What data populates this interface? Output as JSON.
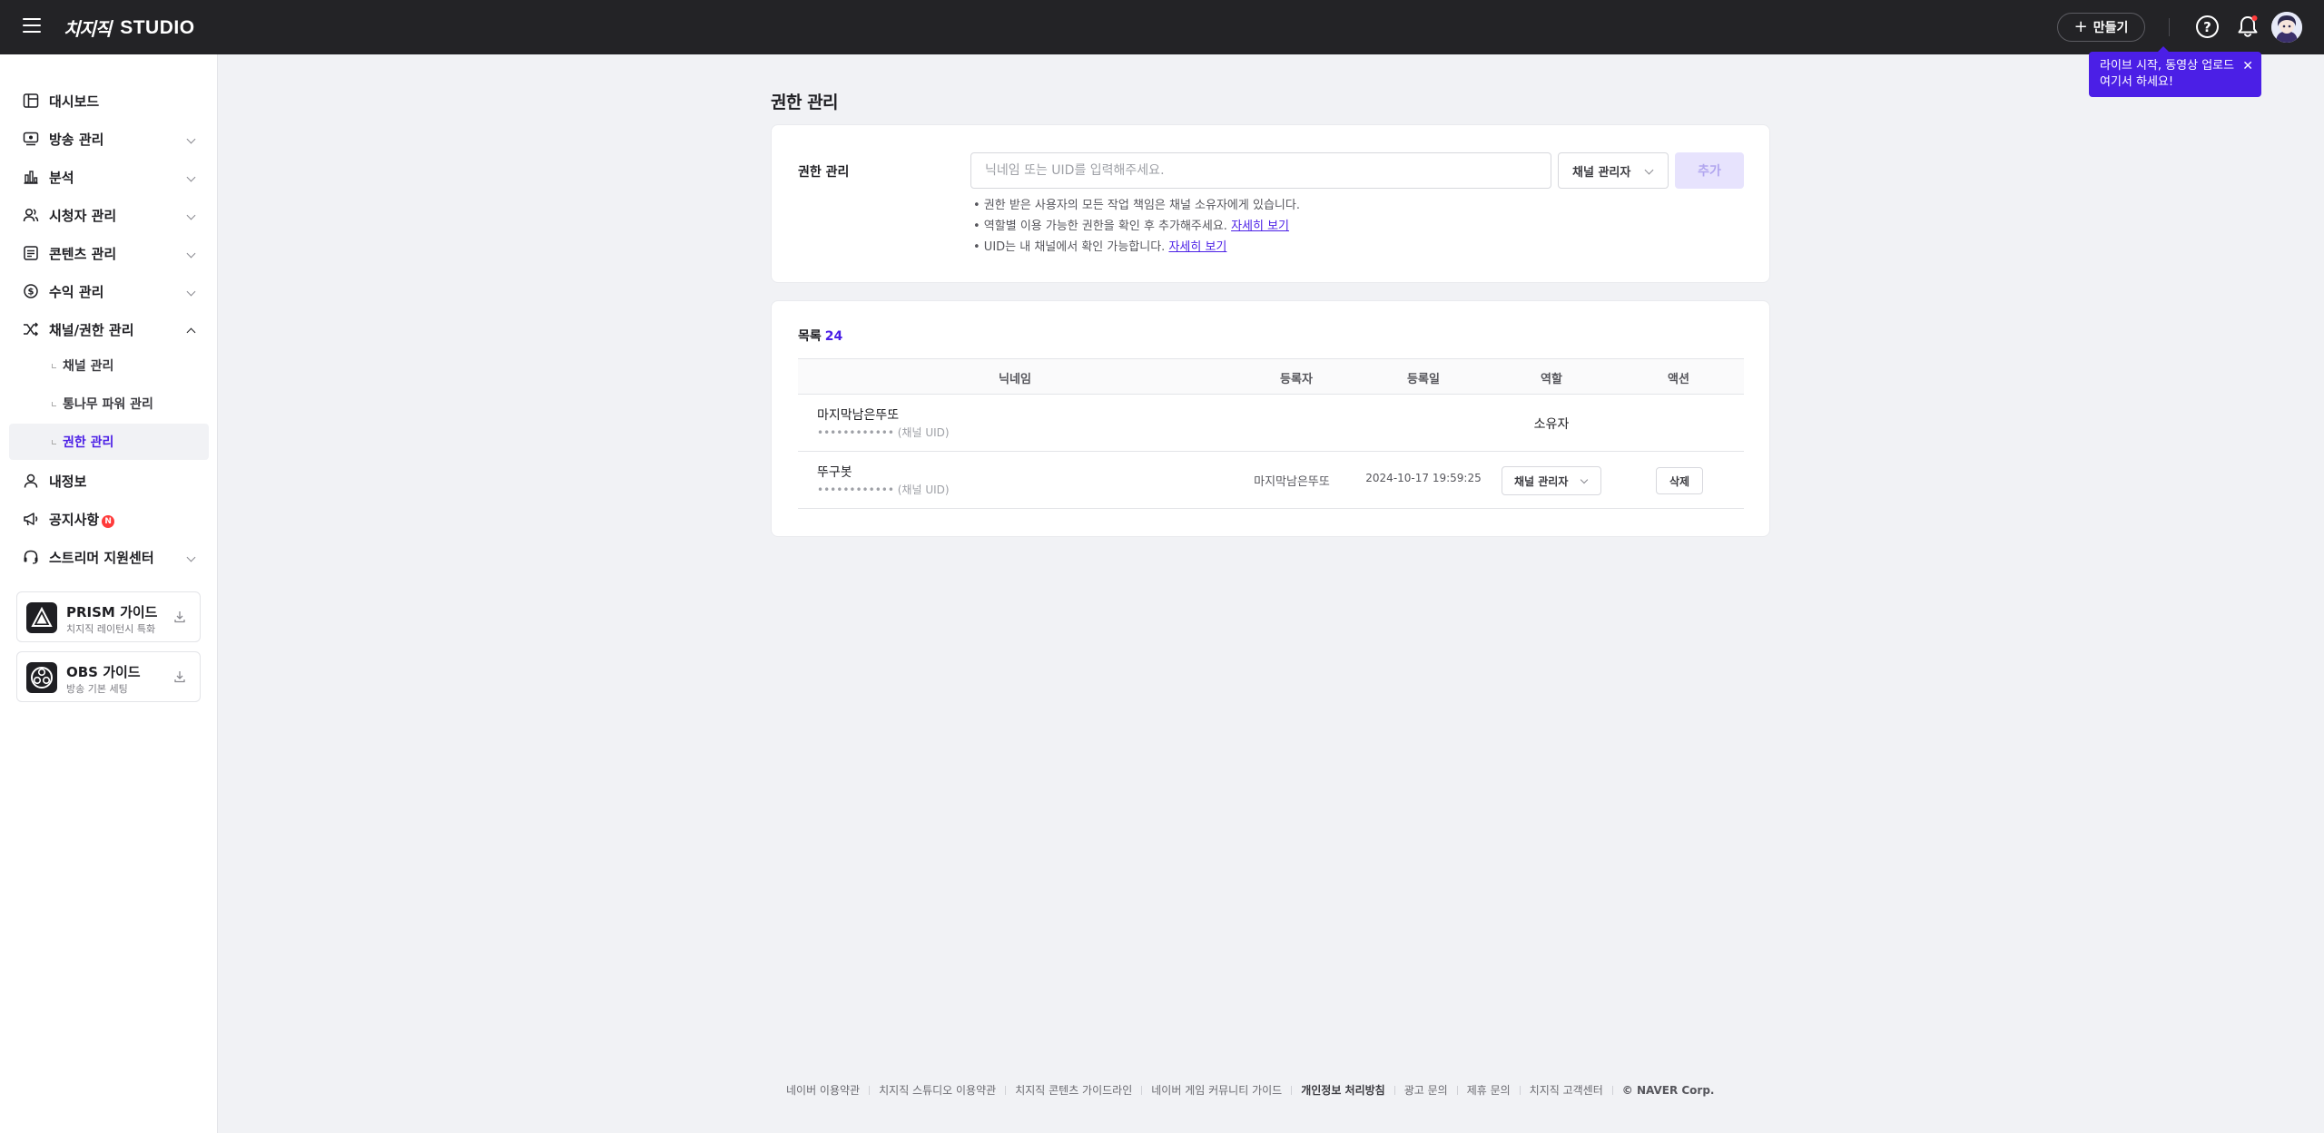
{
  "header": {
    "logo_mark": "치지직",
    "logo_text": "STUDIO",
    "create_button": "만들기",
    "icons": [
      "menu-icon",
      "help-icon",
      "bell-icon",
      "avatar"
    ]
  },
  "tooltip": {
    "line1": "라이브 시작, 동영상 업로드",
    "line2": "여기서 하세요!"
  },
  "sidebar": {
    "items": [
      {
        "label": "대시보드",
        "icon": "dashboard-icon"
      },
      {
        "label": "방송 관리",
        "icon": "broadcast-icon"
      },
      {
        "label": "분석",
        "icon": "analytics-icon"
      },
      {
        "label": "시청자 관리",
        "icon": "viewer-icon"
      },
      {
        "label": "콘텐츠 관리",
        "icon": "content-icon"
      },
      {
        "label": "수익 관리",
        "icon": "revenue-icon"
      },
      {
        "label": "채널/권한 관리",
        "icon": "shuffle-icon"
      }
    ],
    "sub_items": [
      {
        "label": "채널 관리"
      },
      {
        "label": "통나무 파워 관리"
      },
      {
        "label": "권한 관리",
        "active": true
      }
    ],
    "items_after": [
      {
        "label": "내정보",
        "icon": "person-icon"
      },
      {
        "label": "공지사항",
        "icon": "megaphone-icon",
        "badge": "N"
      },
      {
        "label": "스트리머 지원센터",
        "icon": "headset-icon"
      }
    ],
    "guides": [
      {
        "title": "PRISM 가이드",
        "subtitle": "치지직 레이턴시 특화"
      },
      {
        "title": "OBS 가이드",
        "subtitle": "방송 기본 세팅"
      }
    ]
  },
  "main": {
    "page_title": "권한 관리",
    "form": {
      "label": "권한 관리",
      "input_placeholder": "닉네임 또는 UID를 입력해주세요.",
      "role_select": "채널 관리자",
      "add_button": "추가",
      "notes": [
        {
          "text": "• 권한 받은 사용자의 모든 작업 책임은 채널 소유자에게 있습니다.",
          "link": ""
        },
        {
          "text": "• 역할별 이용 가능한 권한을 확인 후 추가해주세요.",
          "link": "자세히 보기"
        },
        {
          "text": "• UID는 내 채널에서 확인 가능합니다.",
          "link": "자세히 보기"
        }
      ]
    },
    "list": {
      "label": "목록",
      "count": "24",
      "columns": [
        "닉네임",
        "등록자",
        "등록일",
        "역할",
        "액션"
      ],
      "rows": [
        {
          "nickname": "마지막남은뚜또",
          "uid": "•••••••••••• (채널 UID)",
          "registrar": "",
          "date": "",
          "role": "소유자",
          "action": ""
        },
        {
          "nickname": "뚜구봇",
          "uid": "•••••••••••• (채널 UID)",
          "registrar": "마지막남은뚜또",
          "date": "2024-10-17 19:59:25",
          "role": "채널 관리자",
          "action": "삭제"
        }
      ]
    }
  },
  "footer": {
    "links": [
      "네이버 이용약관",
      "치지직 스튜디오 이용약관",
      "치지직 콘텐츠 가이드라인",
      "네이버 게임 커뮤니티 가이드",
      "개인정보 처리방침",
      "광고 문의",
      "제휴 문의",
      "치지직 고객센터"
    ],
    "copyright": "© NAVER Corp."
  },
  "colors": {
    "accent": "#4b1fe6",
    "header_bg": "#232326",
    "page_bg": "#f1f2f5"
  }
}
